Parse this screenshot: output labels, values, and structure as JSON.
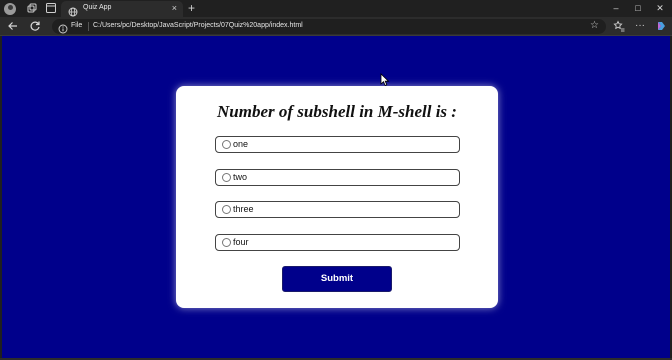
{
  "browser": {
    "tab_title": "Quiz App",
    "tab_close": "×",
    "new_tab": "+",
    "address_scheme_label": "File",
    "url": "C:/Users/pc/Desktop/JavaScript/Projects/07Quiz%20app/index.html",
    "window_controls": {
      "minimize": "–",
      "maximize": "□",
      "close": "✕"
    },
    "icons": [
      "profile-icon",
      "workspaces-icon",
      "tab-actions-icon",
      "globe-icon",
      "back-icon",
      "refresh-icon",
      "info-icon",
      "star-icon",
      "favorites-icon",
      "more-icon",
      "copilot-icon"
    ]
  },
  "quiz": {
    "question": "Number of subshell in M-shell is :",
    "options": [
      {
        "label": "one"
      },
      {
        "label": "two"
      },
      {
        "label": "three"
      },
      {
        "label": "four"
      }
    ],
    "submit_label": "Submit"
  },
  "colors": {
    "page_background": "#00008b",
    "card_background": "#ffffff",
    "submit_background": "#00008b"
  }
}
